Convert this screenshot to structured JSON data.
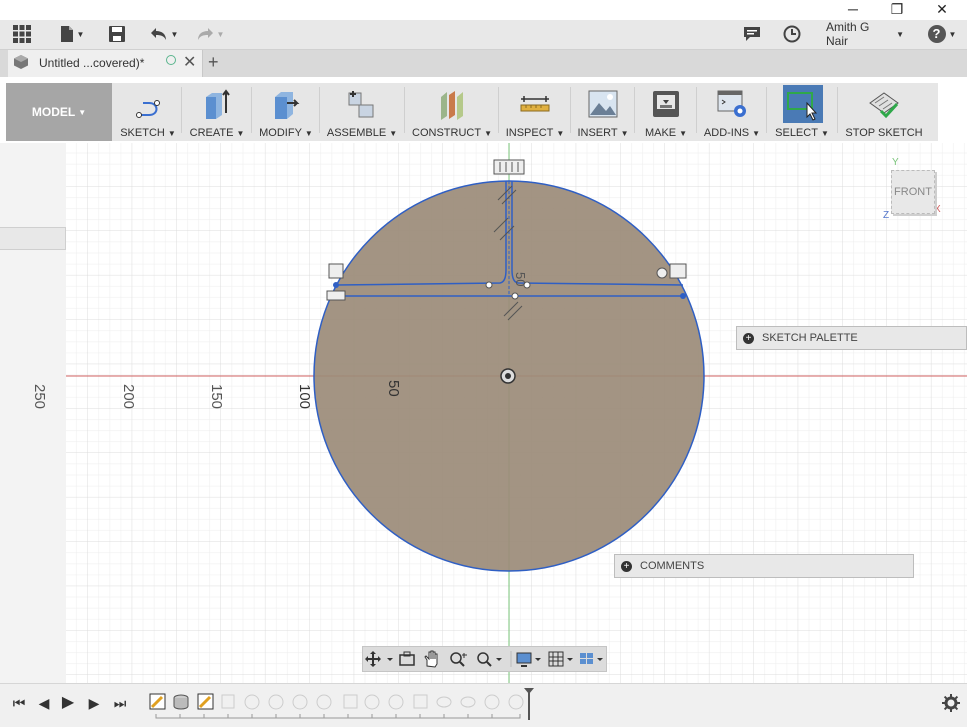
{
  "window": {
    "minimize": "─",
    "restore": "❐",
    "close": "✕"
  },
  "qat": {
    "user": "Amith G Nair",
    "help": "?"
  },
  "tab": {
    "title": "Untitled ...covered)*",
    "add": "+"
  },
  "ribbon": {
    "workspace": "MODEL",
    "groups": [
      {
        "label": "SKETCH",
        "icon": "sketch-icon"
      },
      {
        "label": "CREATE",
        "icon": "create-icon"
      },
      {
        "label": "MODIFY",
        "icon": "modify-icon"
      },
      {
        "label": "ASSEMBLE",
        "icon": "assemble-icon"
      },
      {
        "label": "CONSTRUCT",
        "icon": "construct-icon"
      },
      {
        "label": "INSPECT",
        "icon": "inspect-icon"
      },
      {
        "label": "INSERT",
        "icon": "insert-icon"
      },
      {
        "label": "MAKE",
        "icon": "make-icon"
      },
      {
        "label": "ADD-INS",
        "icon": "add-ins-icon"
      },
      {
        "label": "SELECT",
        "icon": "select-icon"
      },
      {
        "label": "STOP SKETCH",
        "icon": "stop-sketch-icon"
      }
    ]
  },
  "viewcube": {
    "face": "FRONT",
    "axis_y": "Y",
    "axis_z": "Z",
    "axis_x": "X"
  },
  "rulers": {
    "labels": [
      "250",
      "200",
      "150",
      "100",
      "50",
      "50"
    ]
  },
  "panels": {
    "sketch_palette": "SKETCH PALETTE",
    "comments": "COMMENTS"
  },
  "colors": {
    "accent": "#4a7ab5",
    "sketch_fill": "#9b8b78",
    "sketch_line": "#2f5fc4",
    "x_axis": "#d06060",
    "y_axis": "#7ac47a"
  }
}
